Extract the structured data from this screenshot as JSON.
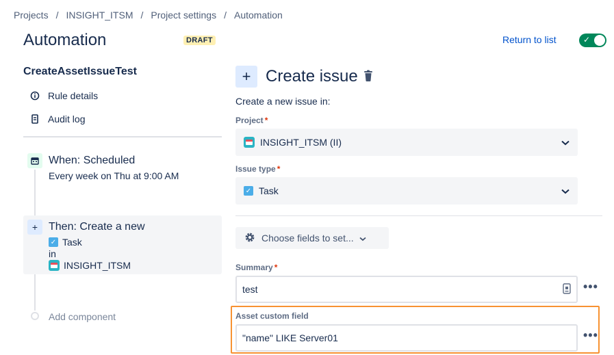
{
  "breadcrumbs": [
    "Projects",
    "INSIGHT_ITSM",
    "Project settings",
    "Automation"
  ],
  "header": {
    "title": "Automation",
    "badge": "DRAFT",
    "return_link": "Return to list",
    "toggle_on": true
  },
  "sidebar": {
    "rule_name": "CreateAssetIssueTest",
    "items": [
      {
        "label": "Rule details",
        "icon": "info-icon"
      },
      {
        "label": "Audit log",
        "icon": "document-icon"
      }
    ],
    "trigger": {
      "title": "When: Scheduled",
      "subtitle": "Every week on Thu at 9:00 AM"
    },
    "action": {
      "title": "Then: Create a new",
      "issue_type": "Task",
      "in_text": "in",
      "project": "INSIGHT_ITSM"
    },
    "add_component": "Add component"
  },
  "main": {
    "title": "Create issue",
    "subtitle": "Create a new issue in:",
    "project_label": "Project",
    "project_value": "INSIGHT_ITSM (II)",
    "issue_type_label": "Issue type",
    "issue_type_value": "Task",
    "choose_fields": "Choose fields to set...",
    "summary_label": "Summary",
    "summary_value": "test",
    "asset_label": "Asset custom field",
    "asset_value": "\"name\" LIKE Server01",
    "required_mark": "*"
  },
  "colors": {
    "accent": "#0052cc",
    "toggle": "#00875a",
    "highlight": "#f79232",
    "required": "#de350b"
  }
}
